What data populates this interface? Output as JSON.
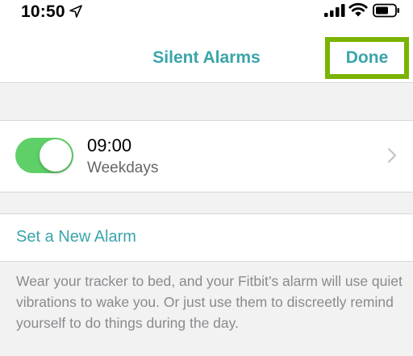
{
  "status_bar": {
    "time": "10:50"
  },
  "nav": {
    "title": "Silent Alarms",
    "done_label": "Done"
  },
  "alarm": {
    "time": "09:00",
    "days": "Weekdays",
    "enabled": true
  },
  "new_alarm": {
    "label": "Set a New Alarm"
  },
  "description": "Wear your tracker to bed, and your Fitbit’s alarm will use quiet vibrations to wake you. Or just use them to discreetly remind yourself to do things during the day.",
  "colors": {
    "accent": "#3aa5a9",
    "toggle_on": "#5fd068",
    "highlight": "#7ab300",
    "background": "#f2f2f3"
  },
  "icons": [
    "location-arrow-icon",
    "cellular-signal-icon",
    "wifi-icon",
    "battery-icon",
    "chevron-right-icon"
  ]
}
